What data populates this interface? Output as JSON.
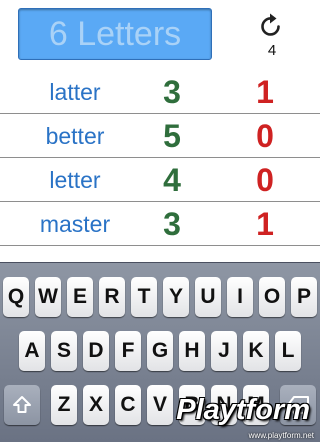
{
  "header": {
    "input_placeholder": "6 Letters",
    "reset_icon": "refresh-icon",
    "reset_count": "4"
  },
  "guesses": [
    {
      "word": "latter",
      "bulls": "3",
      "cows": "1"
    },
    {
      "word": "better",
      "bulls": "5",
      "cows": "0"
    },
    {
      "word": "letter",
      "bulls": "4",
      "cows": "0"
    },
    {
      "word": "master",
      "bulls": "3",
      "cows": "1"
    }
  ],
  "keyboard": {
    "row1": [
      "Q",
      "W",
      "E",
      "R",
      "T",
      "Y",
      "U",
      "I",
      "O",
      "P"
    ],
    "row2": [
      "A",
      "S",
      "D",
      "F",
      "G",
      "H",
      "J",
      "K",
      "L"
    ],
    "row3": [
      "Z",
      "X",
      "C",
      "V",
      "B",
      "N",
      "M"
    ],
    "shift_icon": "shift-arrow-icon",
    "delete_icon": "delete-icon"
  },
  "colors": {
    "word": "#2a73c6",
    "bulls": "#2f6e3c",
    "cows": "#cf2222",
    "input_bg": "#5aa9f5"
  },
  "watermark": {
    "brand": "Playtform",
    "url": "www.playtform.net"
  }
}
